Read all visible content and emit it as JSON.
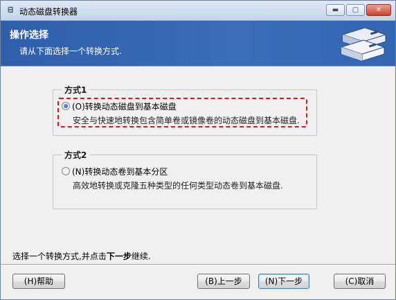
{
  "window": {
    "title": "动态磁盘转换器",
    "icon_glyph": "ᗺ"
  },
  "titlebar": {
    "min_glyph": "▬",
    "max_glyph": "▢",
    "close_glyph": "✕"
  },
  "header": {
    "title": "操作选择",
    "subtitle": "请从下面选择一个转换方式."
  },
  "options": [
    {
      "group_label": "方式1",
      "label": "(O)转换动态磁盘到基本磁盘",
      "description": "安全与快速地转换包含简单卷或镜像卷的动态磁盘到基本磁盘.",
      "selected": true
    },
    {
      "group_label": "方式2",
      "label": "(N)转换动态卷到基本分区",
      "description": "高效地转换或克隆五种类型的任何类型动态卷到基本磁盘.",
      "selected": false
    }
  ],
  "footer": {
    "hint_prefix": "选择一个转换方式,并点击",
    "hint_bold": "下一步",
    "hint_suffix": "继续."
  },
  "buttons": {
    "help": "(H)帮助",
    "back": "(B)上一步",
    "next": "(N)下一步",
    "cancel": "(C)取消"
  },
  "colors": {
    "banner": "#3367b3",
    "focus_outline": "#e0141e"
  }
}
